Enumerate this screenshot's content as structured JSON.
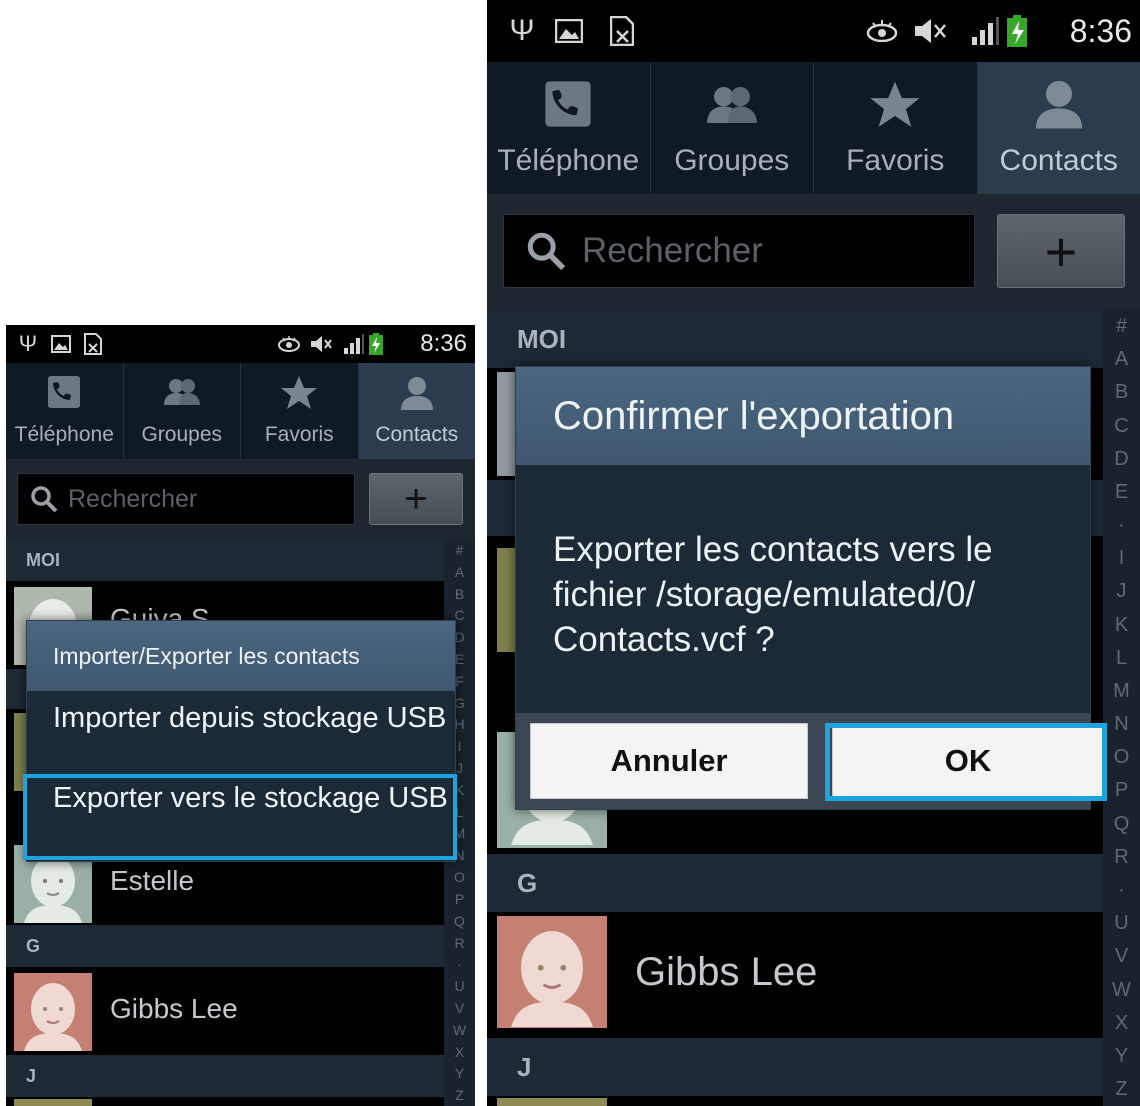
{
  "status_bar": {
    "time": "8:36"
  },
  "tabs": [
    {
      "label": "Téléphone",
      "icon": "phone-icon"
    },
    {
      "label": "Groupes",
      "icon": "groups-icon"
    },
    {
      "label": "Favoris",
      "icon": "star-icon"
    },
    {
      "label": "Contacts",
      "icon": "contact-icon",
      "active": true
    }
  ],
  "search": {
    "placeholder": "Rechercher",
    "add_label": "+"
  },
  "sections": {
    "me": "MOI",
    "g": "G",
    "j": "J"
  },
  "contacts": {
    "me_partial": "Guiya S",
    "estelle": "Estelle",
    "gibbs": "Gibbs Lee"
  },
  "index_left": [
    "#",
    "A",
    "B",
    "C",
    "D",
    "E",
    "F",
    "G",
    "H",
    "I",
    "J",
    "K",
    "L",
    "M",
    "N",
    "O",
    "P",
    "Q",
    "R",
    "·",
    "U",
    "V",
    "W",
    "X",
    "Y",
    "Z"
  ],
  "index_right": [
    "#",
    "A",
    "B",
    "C",
    "D",
    "E",
    "·",
    "I",
    "J",
    "K",
    "L",
    "M",
    "N",
    "O",
    "P",
    "Q",
    "R",
    "·",
    "U",
    "V",
    "W",
    "X",
    "Y",
    "Z"
  ],
  "dialog_left": {
    "title": "Importer/Exporter les contacts",
    "items": [
      "Importer depuis stockage USB",
      "Exporter vers le stockage USB"
    ]
  },
  "dialog_right": {
    "title": "Confirmer l'exportation",
    "message": "Exporter les contacts vers le fichier /storage/emulated/0/ Contacts.vcf ?",
    "cancel": "Annuler",
    "ok": "OK"
  },
  "colors": {
    "highlight": "#1fa3de",
    "dialog_title": "#4a6480",
    "active_tab": "#2a3c4e"
  }
}
